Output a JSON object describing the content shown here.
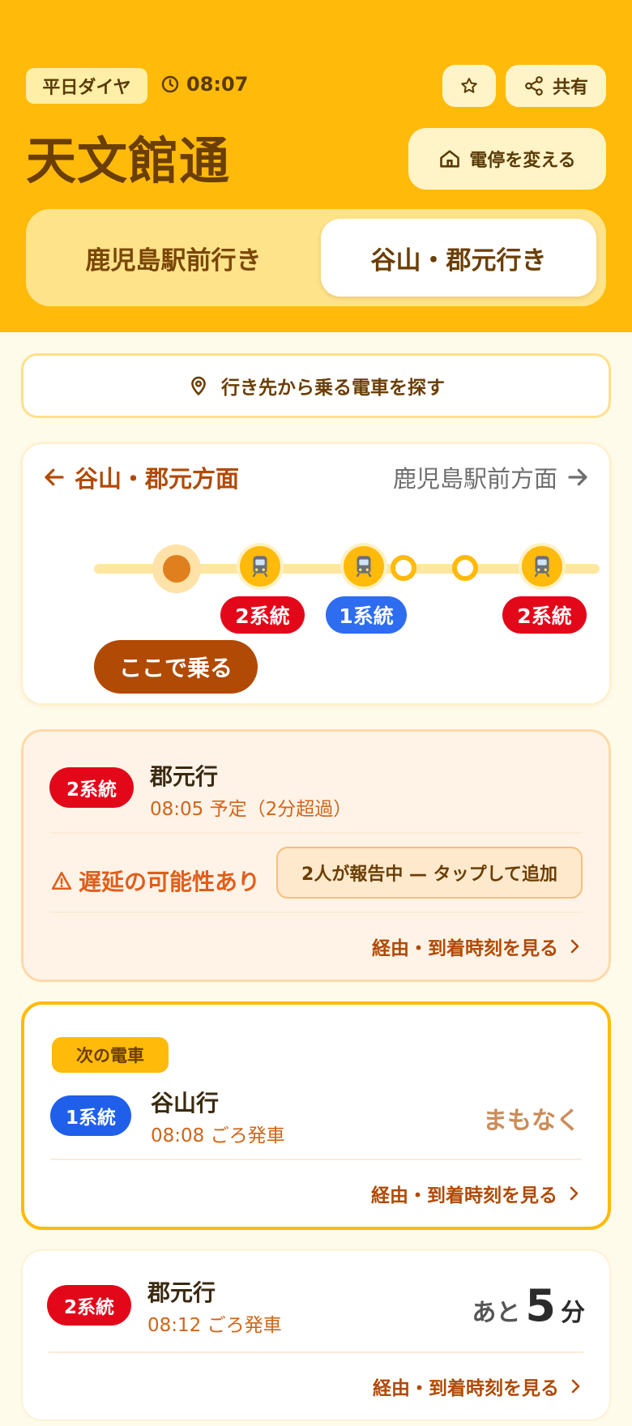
{
  "header": {
    "day_type": "平日ダイヤ",
    "time": "08:07",
    "share_label": "共有",
    "stop_name": "天文館通",
    "change_stop_label": "電停を変える",
    "direction_tabs": [
      "鹿児島駅前行き",
      "谷山・郡元行き"
    ],
    "selected_tab": 1
  },
  "search": {
    "label": "行き先から乗る電車を探す"
  },
  "route_map": {
    "current_direction": "谷山・郡元方面",
    "other_direction": "鹿児島駅前方面",
    "trams": [
      {
        "line": "2系統",
        "color": "#E3071A"
      },
      {
        "line": "1系統",
        "color": "#2E6CF0"
      },
      {
        "line": "2系統",
        "color": "#E3071A"
      }
    ],
    "board_here_label": "ここで乗る"
  },
  "departures": [
    {
      "line": "2系統",
      "line_color": "#E3071A",
      "destination": "郡元行",
      "time_text": "08:05 予定（2分超過）",
      "warning": "遅延の可能性あり",
      "report_label": "2人が報告中 — タップして追加",
      "detail_label": "経由・到着時刻を見る"
    },
    {
      "tag": "次の電車",
      "line": "1系統",
      "line_color": "#1F5FEA",
      "destination": "谷山行",
      "time_text": "08:08 ごろ発車",
      "status": "まもなく",
      "detail_label": "経由・到着時刻を見る"
    },
    {
      "line": "2系統",
      "line_color": "#E3071A",
      "destination": "郡元行",
      "time_text": "08:12 ごろ発車",
      "remain_prefix": "あと",
      "remain_minutes": "5",
      "remain_unit": "分",
      "detail_label": "経由・到着時刻を見る"
    }
  ],
  "colors": {
    "header_bg": "#FFBA0A",
    "accent_brown": "#B14A04",
    "line2_red": "#E3071A",
    "line1_blue": "#2E6CF0"
  }
}
